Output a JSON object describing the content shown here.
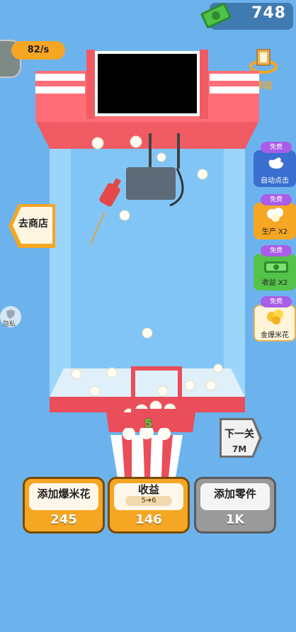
{
  "currency": {
    "amount": "748",
    "icon": "cash-icon",
    "color": "#3da83a"
  },
  "rate": {
    "text": "82/s"
  },
  "rotate": {
    "label": "转动"
  },
  "shop": {
    "label": "去商店"
  },
  "privacy": {
    "label": "隐私"
  },
  "boosters": [
    {
      "badge": "免费",
      "label": "自动点击",
      "color": "#3a6fd0",
      "icon": "hand-tap-icon"
    },
    {
      "badge": "免费",
      "label": "生产 X2",
      "color": "#f5a623",
      "icon": "popcorn-icon"
    },
    {
      "badge": "免费",
      "label": "收益 X2",
      "color": "#55c24a",
      "icon": "cash-icon"
    },
    {
      "badge": "免费",
      "label": "金爆米花",
      "color": "#fff4d8",
      "icon": "golden-popcorn-icon"
    }
  ],
  "next_level": {
    "label": "下一关",
    "cost": "7M"
  },
  "floating": [
    "5",
    "5"
  ],
  "actions": {
    "add_popcorn": {
      "label": "添加爆米花",
      "value": "245"
    },
    "income": {
      "label": "收益",
      "sub": "5➔6",
      "value": "146"
    },
    "add_part": {
      "label": "添加零件",
      "value": "1K"
    }
  }
}
